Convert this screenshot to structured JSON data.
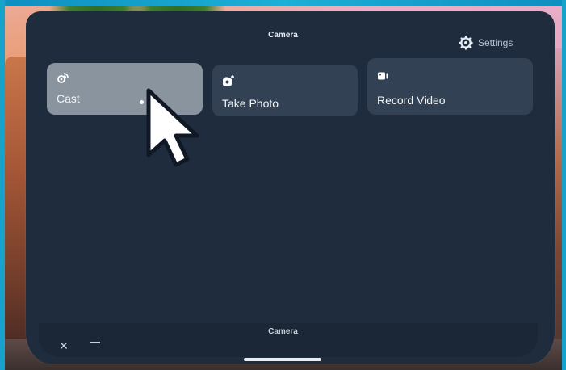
{
  "window": {
    "title": "Camera",
    "footer_title": "Camera"
  },
  "header": {
    "settings_label": "Settings",
    "settings_icon": "gear-icon"
  },
  "tiles": [
    {
      "id": "cast",
      "label": "Cast",
      "icon": "cast-icon",
      "state": "hovered"
    },
    {
      "id": "photo",
      "label": "Take Photo",
      "icon": "camera-icon"
    },
    {
      "id": "video",
      "label": "Record Video",
      "icon": "video-camera-icon"
    }
  ],
  "footer": {
    "close_icon": "close-icon",
    "minimize_icon": "minimize-icon"
  },
  "colors": {
    "panel": "#1f2c3e",
    "tile": "#324154",
    "tile_hover": "#8a949f",
    "text": "#f2f5f8"
  }
}
